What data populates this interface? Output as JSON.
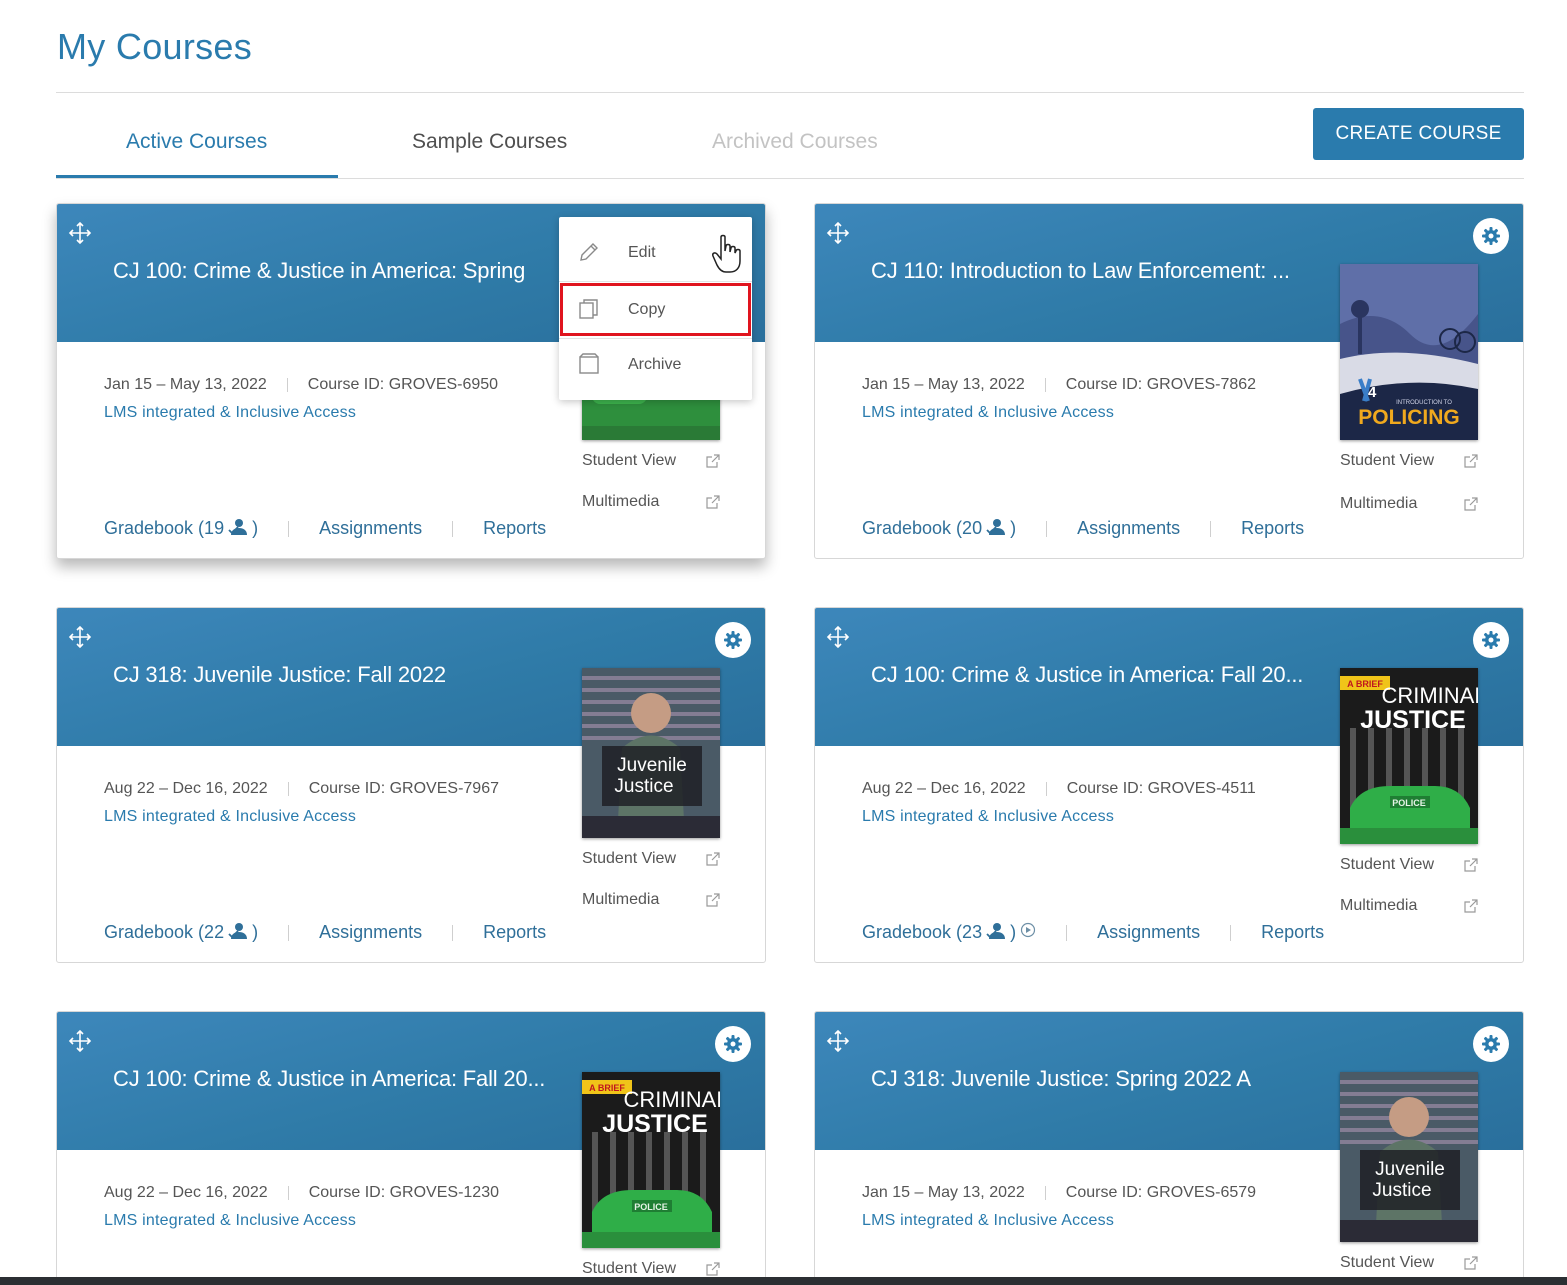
{
  "page": {
    "title": "My Courses"
  },
  "tabs": [
    {
      "label": "Active Courses",
      "state": "active"
    },
    {
      "label": "Sample Courses",
      "state": "normal"
    },
    {
      "label": "Archived Courses",
      "state": "disabled"
    }
  ],
  "create_button": {
    "label": "CREATE COURSE"
  },
  "context_menu": {
    "items": [
      {
        "label": "Edit",
        "icon": "pencil-icon"
      },
      {
        "label": "Copy",
        "icon": "copy-icon",
        "highlighted": true
      },
      {
        "label": "Archive",
        "icon": "archive-icon"
      }
    ]
  },
  "labels": {
    "student_view": "Student View",
    "multimedia": "Multimedia",
    "assignments": "Assignments",
    "reports": "Reports"
  },
  "courses": [
    {
      "title": "CJ 100: Crime & Justice in America: Spring ...",
      "dates": "Jan 15 – May 13, 2022",
      "course_id": "Course ID: GROVES-6950",
      "lms": "LMS integrated & Inclusive Access",
      "gradebook_prefix": "Gradebook (19",
      "gradebook_suffix": ")",
      "book": "criminal-justice",
      "menu_open": true
    },
    {
      "title": "CJ 110: Introduction to Law Enforcement: ...",
      "dates": "Jan 15 – May 13, 2022",
      "course_id": "Course ID: GROVES-7862",
      "lms": "LMS integrated & Inclusive Access",
      "gradebook_prefix": "Gradebook (20",
      "gradebook_suffix": ")",
      "book": "policing",
      "book_text": {
        "edition": "4",
        "subtitle": "INTRODUCTION TO",
        "title": "POLICING"
      }
    },
    {
      "title": "CJ 318: Juvenile Justice: Fall 2022",
      "dates": "Aug 22 – Dec 16, 2022",
      "course_id": "Course ID: GROVES-7967",
      "lms": "LMS integrated & Inclusive Access",
      "gradebook_prefix": "Gradebook (22",
      "gradebook_suffix": ")",
      "book": "juvenile-justice",
      "book_text": {
        "line1": "Juvenile",
        "line2": "Justice"
      }
    },
    {
      "title": "CJ 100: Crime & Justice in America: Fall 20...",
      "dates": "Aug 22 – Dec 16, 2022",
      "course_id": "Course ID: GROVES-4511",
      "lms": "LMS integrated & Inclusive Access",
      "gradebook_prefix": "Gradebook (23",
      "gradebook_suffix": ")",
      "book": "criminal-justice",
      "book_text": {
        "tag": "A BRIEF",
        "line1": "CRIMINAL",
        "line2": "JUSTICE",
        "car": "POLICE"
      }
    },
    {
      "title": "CJ 100: Crime & Justice in America: Fall 20...",
      "dates": "Aug 22 – Dec 16, 2022",
      "course_id": "Course ID: GROVES-1230",
      "lms": "LMS integrated & Inclusive Access",
      "book": "criminal-justice",
      "book_text": {
        "tag": "A BRIEF",
        "line1": "CRIMINAL",
        "line2": "JUSTICE",
        "car": "POLICE"
      }
    },
    {
      "title": "CJ 318: Juvenile Justice: Spring 2022 A",
      "dates": "Jan 15 – May 13, 2022",
      "course_id": "Course ID: GROVES-6579",
      "lms": "LMS integrated & Inclusive Access",
      "book": "juvenile-justice",
      "book_text": {
        "line1": "Juvenile",
        "line2": "Justice"
      }
    }
  ],
  "colors": {
    "accent": "#2a7bad",
    "header": "#2f7ba8",
    "highlight": "#e0141e"
  }
}
